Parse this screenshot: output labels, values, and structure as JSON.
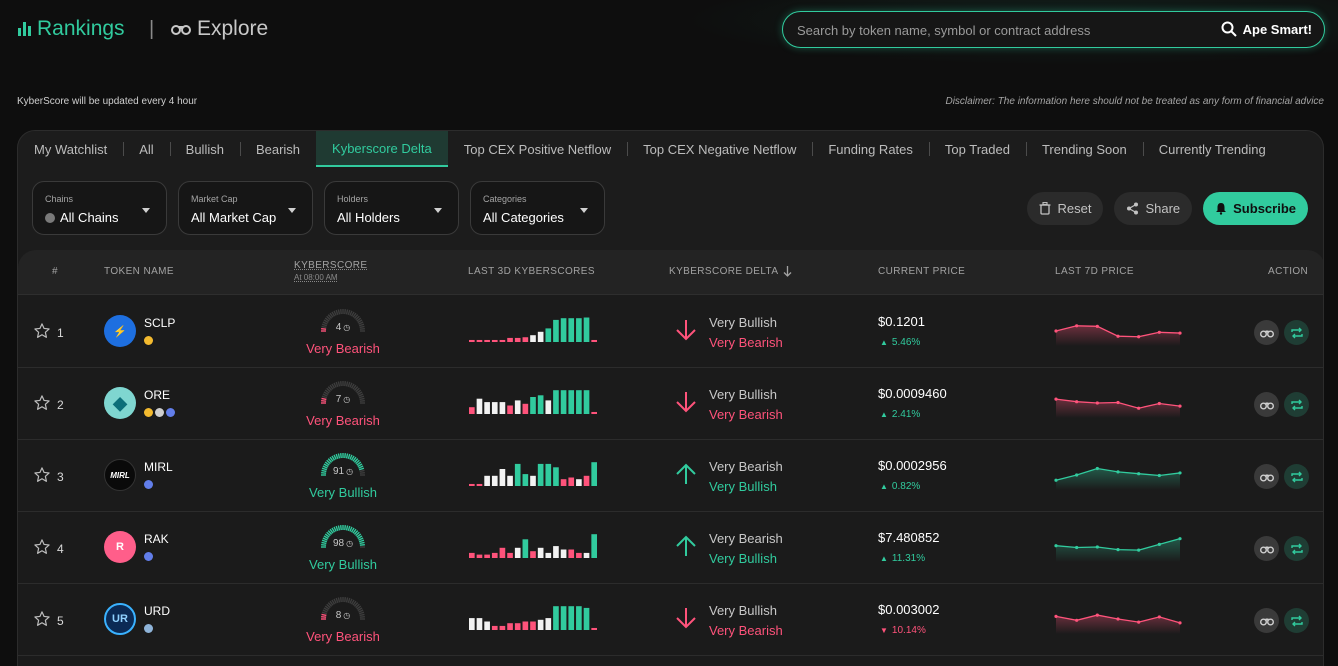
{
  "colors": {
    "accent": "#31cb9e",
    "bearish": "#ff537b",
    "bullish": "#31cb9e",
    "background": "#0e0e0e",
    "panel": "#1c1c1c"
  },
  "header": {
    "rankings_label": "Rankings",
    "explore_label": "Explore",
    "separator": "|",
    "search_placeholder": "Search by token name, symbol or contract address",
    "search_button": "Ape Smart!"
  },
  "notes": {
    "update": "KyberScore will be updated every 4 hour",
    "disclaimer": "Disclaimer: The information here should not be treated as any form of financial advice"
  },
  "tabs": [
    {
      "label": "My Watchlist",
      "active": false
    },
    {
      "label": "All",
      "active": false
    },
    {
      "label": "Bullish",
      "active": false
    },
    {
      "label": "Bearish",
      "active": false
    },
    {
      "label": "Kyberscore Delta",
      "active": true
    },
    {
      "label": "Top CEX Positive Netflow",
      "active": false
    },
    {
      "label": "Top CEX Negative Netflow",
      "active": false
    },
    {
      "label": "Funding Rates",
      "active": false
    },
    {
      "label": "Top Traded",
      "active": false
    },
    {
      "label": "Trending Soon",
      "active": false
    },
    {
      "label": "Currently Trending",
      "active": false
    }
  ],
  "filters": [
    {
      "label": "Chains",
      "value": "All Chains",
      "icon": "chain-icon"
    },
    {
      "label": "Market Cap",
      "value": "All Market Cap"
    },
    {
      "label": "Holders",
      "value": "All Holders"
    },
    {
      "label": "Categories",
      "value": "All Categories"
    }
  ],
  "actions": {
    "reset": "Reset",
    "share": "Share",
    "subscribe": "Subscribe"
  },
  "columns": {
    "rank": "#",
    "token": "TOKEN NAME",
    "kyberscore": "KYBERSCORE",
    "kyberscore_sub": "At 08:00 AM",
    "last3d": "LAST 3D KYBERSCORES",
    "delta": "KYBERSCORE DELTA",
    "price": "CURRENT PRICE",
    "last7d": "LAST 7D PRICE",
    "action": "ACTION"
  },
  "rows": [
    {
      "rank": "1",
      "symbol": "SCLP",
      "logo_text": "⚡",
      "logo_bg": "#1e6fe0",
      "chains": [
        "#f3ba2f"
      ],
      "score": 4,
      "score_label": "Very Bearish",
      "score_sentiment": "bear",
      "bars3d": [
        {
          "v": 0.06,
          "c": "bear"
        },
        {
          "v": 0.06,
          "c": "bear"
        },
        {
          "v": 0.06,
          "c": "bear"
        },
        {
          "v": 0.06,
          "c": "bear"
        },
        {
          "v": 0.06,
          "c": "bear"
        },
        {
          "v": 0.12,
          "c": "bear"
        },
        {
          "v": 0.12,
          "c": "bear"
        },
        {
          "v": 0.14,
          "c": "bear"
        },
        {
          "v": 0.2,
          "c": "neutral"
        },
        {
          "v": 0.3,
          "c": "neutral"
        },
        {
          "v": 0.4,
          "c": "bull"
        },
        {
          "v": 0.65,
          "c": "bull"
        },
        {
          "v": 0.7,
          "c": "bull"
        },
        {
          "v": 0.7,
          "c": "bull"
        },
        {
          "v": 0.7,
          "c": "bull"
        },
        {
          "v": 0.72,
          "c": "bull"
        },
        {
          "v": 0.06,
          "c": "bear"
        }
      ],
      "delta_direction": "down",
      "delta_from": "Very Bullish",
      "delta_from_sentiment": "neutral",
      "delta_to": "Very Bearish",
      "delta_to_sentiment": "bear",
      "price": "$0.1201",
      "change": "5.46%",
      "change_direction": "up",
      "spark": [
        0.5,
        0.7,
        0.68,
        0.3,
        0.28,
        0.45,
        0.42
      ],
      "spark_sentiment": "bear"
    },
    {
      "rank": "2",
      "symbol": "ORE",
      "logo_text": "◆",
      "logo_bg": "#7fd6d0",
      "chains": [
        "#f3ba2f",
        "#cfcfcf",
        "#627eea"
      ],
      "score": 7,
      "score_label": "Very Bearish",
      "score_sentiment": "bear",
      "bars3d": [
        {
          "v": 0.2,
          "c": "bear"
        },
        {
          "v": 0.45,
          "c": "neutral"
        },
        {
          "v": 0.35,
          "c": "neutral"
        },
        {
          "v": 0.35,
          "c": "neutral"
        },
        {
          "v": 0.35,
          "c": "neutral"
        },
        {
          "v": 0.25,
          "c": "bear"
        },
        {
          "v": 0.4,
          "c": "neutral"
        },
        {
          "v": 0.3,
          "c": "bear"
        },
        {
          "v": 0.5,
          "c": "bull"
        },
        {
          "v": 0.55,
          "c": "bull"
        },
        {
          "v": 0.4,
          "c": "neutral"
        },
        {
          "v": 0.7,
          "c": "bull"
        },
        {
          "v": 0.7,
          "c": "bull"
        },
        {
          "v": 0.7,
          "c": "bull"
        },
        {
          "v": 0.7,
          "c": "bull"
        },
        {
          "v": 0.7,
          "c": "bull"
        },
        {
          "v": 0.06,
          "c": "bear"
        }
      ],
      "delta_direction": "down",
      "delta_from": "Very Bullish",
      "delta_from_sentiment": "neutral",
      "delta_to": "Very Bearish",
      "delta_to_sentiment": "bear",
      "price": "$0.0009460",
      "change": "2.41%",
      "change_direction": "up",
      "spark": [
        0.65,
        0.55,
        0.5,
        0.52,
        0.3,
        0.48,
        0.38
      ],
      "spark_sentiment": "bear"
    },
    {
      "rank": "3",
      "symbol": "MIRL",
      "logo_text": "MIRL",
      "logo_bg": "#0a0a0a",
      "chains": [
        "#627eea"
      ],
      "score": 91,
      "score_label": "Very Bullish",
      "score_sentiment": "bull",
      "bars3d": [
        {
          "v": 0.06,
          "c": "bear"
        },
        {
          "v": 0.06,
          "c": "bear"
        },
        {
          "v": 0.3,
          "c": "neutral"
        },
        {
          "v": 0.3,
          "c": "neutral"
        },
        {
          "v": 0.5,
          "c": "neutral"
        },
        {
          "v": 0.3,
          "c": "neutral"
        },
        {
          "v": 0.65,
          "c": "bull"
        },
        {
          "v": 0.35,
          "c": "bull"
        },
        {
          "v": 0.3,
          "c": "neutral"
        },
        {
          "v": 0.65,
          "c": "bull"
        },
        {
          "v": 0.65,
          "c": "bull"
        },
        {
          "v": 0.55,
          "c": "bull"
        },
        {
          "v": 0.2,
          "c": "bear"
        },
        {
          "v": 0.25,
          "c": "bear"
        },
        {
          "v": 0.2,
          "c": "neutral"
        },
        {
          "v": 0.3,
          "c": "bear"
        },
        {
          "v": 0.7,
          "c": "bull"
        }
      ],
      "delta_direction": "up",
      "delta_from": "Very Bearish",
      "delta_from_sentiment": "neutral",
      "delta_to": "Very Bullish",
      "delta_to_sentiment": "bull",
      "price": "$0.0002956",
      "change": "0.82%",
      "change_direction": "up",
      "spark": [
        0.3,
        0.5,
        0.75,
        0.62,
        0.55,
        0.48,
        0.58
      ],
      "spark_sentiment": "bull"
    },
    {
      "rank": "4",
      "symbol": "RAK",
      "logo_text": "R",
      "logo_bg": "#ff5e8a",
      "chains": [
        "#627eea"
      ],
      "score": 98,
      "score_label": "Very Bullish",
      "score_sentiment": "bull",
      "bars3d": [
        {
          "v": 0.15,
          "c": "bear"
        },
        {
          "v": 0.1,
          "c": "bear"
        },
        {
          "v": 0.1,
          "c": "bear"
        },
        {
          "v": 0.15,
          "c": "bear"
        },
        {
          "v": 0.3,
          "c": "bear"
        },
        {
          "v": 0.15,
          "c": "bear"
        },
        {
          "v": 0.3,
          "c": "neutral"
        },
        {
          "v": 0.55,
          "c": "bull"
        },
        {
          "v": 0.2,
          "c": "bear"
        },
        {
          "v": 0.3,
          "c": "neutral"
        },
        {
          "v": 0.15,
          "c": "neutral"
        },
        {
          "v": 0.35,
          "c": "neutral"
        },
        {
          "v": 0.25,
          "c": "neutral"
        },
        {
          "v": 0.25,
          "c": "bear"
        },
        {
          "v": 0.15,
          "c": "bear"
        },
        {
          "v": 0.15,
          "c": "neutral"
        },
        {
          "v": 0.7,
          "c": "bull"
        }
      ],
      "delta_direction": "up",
      "delta_from": "Very Bearish",
      "delta_from_sentiment": "neutral",
      "delta_to": "Very Bullish",
      "delta_to_sentiment": "bull",
      "price": "$7.480852",
      "change": "11.31%",
      "change_direction": "up",
      "spark": [
        0.55,
        0.48,
        0.5,
        0.4,
        0.38,
        0.6,
        0.82
      ],
      "spark_sentiment": "bull"
    },
    {
      "rank": "5",
      "symbol": "URD",
      "logo_text": "UR",
      "logo_bg": "#0b2a55",
      "chains": [
        "#8fb4d9"
      ],
      "score": 8,
      "score_label": "Very Bearish",
      "score_sentiment": "bear",
      "bars3d": [
        {
          "v": 0.35,
          "c": "neutral"
        },
        {
          "v": 0.35,
          "c": "neutral"
        },
        {
          "v": 0.25,
          "c": "neutral"
        },
        {
          "v": 0.12,
          "c": "bear"
        },
        {
          "v": 0.12,
          "c": "bear"
        },
        {
          "v": 0.2,
          "c": "bear"
        },
        {
          "v": 0.2,
          "c": "bear"
        },
        {
          "v": 0.25,
          "c": "bear"
        },
        {
          "v": 0.25,
          "c": "bear"
        },
        {
          "v": 0.3,
          "c": "neutral"
        },
        {
          "v": 0.35,
          "c": "neutral"
        },
        {
          "v": 0.7,
          "c": "bull"
        },
        {
          "v": 0.7,
          "c": "bull"
        },
        {
          "v": 0.7,
          "c": "bull"
        },
        {
          "v": 0.7,
          "c": "bull"
        },
        {
          "v": 0.65,
          "c": "bull"
        },
        {
          "v": 0.06,
          "c": "bear"
        }
      ],
      "delta_direction": "down",
      "delta_from": "Very Bullish",
      "delta_from_sentiment": "neutral",
      "delta_to": "Very Bearish",
      "delta_to_sentiment": "bear",
      "price": "$0.003002",
      "change": "10.14%",
      "change_direction": "down",
      "spark": [
        0.6,
        0.45,
        0.65,
        0.5,
        0.38,
        0.58,
        0.35
      ],
      "spark_sentiment": "bear"
    }
  ]
}
